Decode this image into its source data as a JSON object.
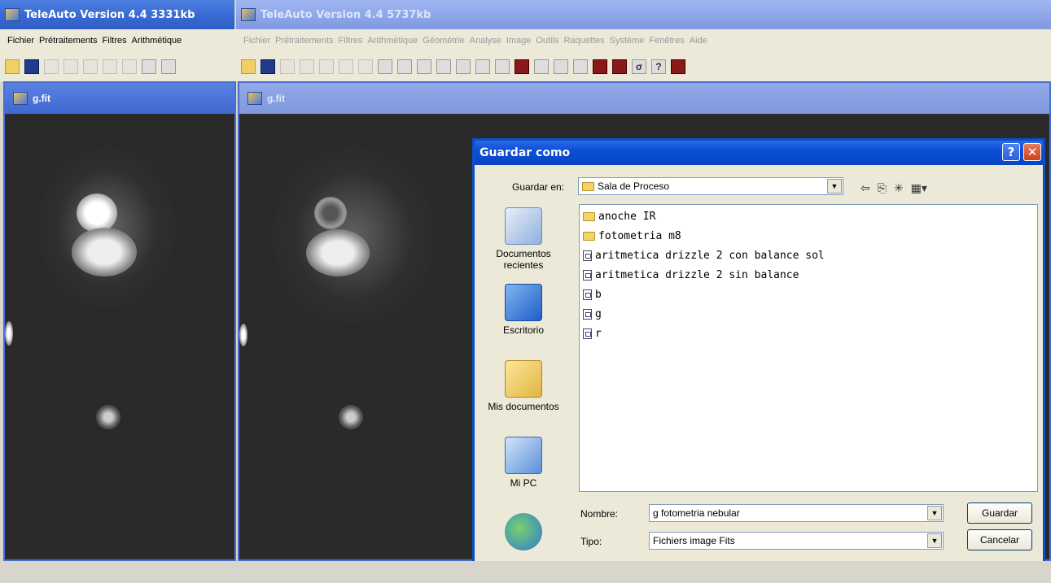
{
  "outer_app": {
    "title": "TeleAuto Version 4.4 3331kb",
    "menu": [
      "Fichier",
      "Prétraitements",
      "Filtres",
      "Arithmétique"
    ]
  },
  "inner_app": {
    "title": "TeleAuto Version 4.4 5737kb",
    "menu": [
      "Fichier",
      "Prétraitements",
      "Filtres",
      "Arithmétique",
      "Géométrie",
      "Analyse",
      "Image",
      "Outils",
      "Raquettes",
      "Système",
      "Fenêtres",
      "Aide"
    ]
  },
  "left_window": {
    "title": "g.fit"
  },
  "right_window": {
    "title": "g.fit"
  },
  "dialog": {
    "title": "Guardar como",
    "help_glyph": "?",
    "close_glyph": "✕",
    "save_in_label": "Guardar en:",
    "save_in_value": "Sala de Proceso",
    "places": [
      "Documentos recientes",
      "Escritorio",
      "Mis documentos",
      "Mi PC",
      ""
    ],
    "files": [
      {
        "name": "anoche IR",
        "type": "folder"
      },
      {
        "name": "fotometria m8",
        "type": "folder"
      },
      {
        "name": "aritmetica drizzle 2 con balance sol",
        "type": "file"
      },
      {
        "name": "aritmetica drizzle 2 sin balance",
        "type": "file"
      },
      {
        "name": "b",
        "type": "file"
      },
      {
        "name": "g",
        "type": "file"
      },
      {
        "name": "r",
        "type": "file"
      }
    ],
    "name_label": "Nombre:",
    "name_value": "g fotometria nebular",
    "type_label": "Tipo:",
    "type_value": "Fichiers image Fits",
    "save_button": "Guardar",
    "cancel_button": "Cancelar"
  },
  "toolbar_glyphs": {
    "sigma": "σ",
    "question": "?"
  },
  "colors": {
    "xp_blue": "#0a4fd6",
    "dialog_bg": "#ece9d8"
  }
}
